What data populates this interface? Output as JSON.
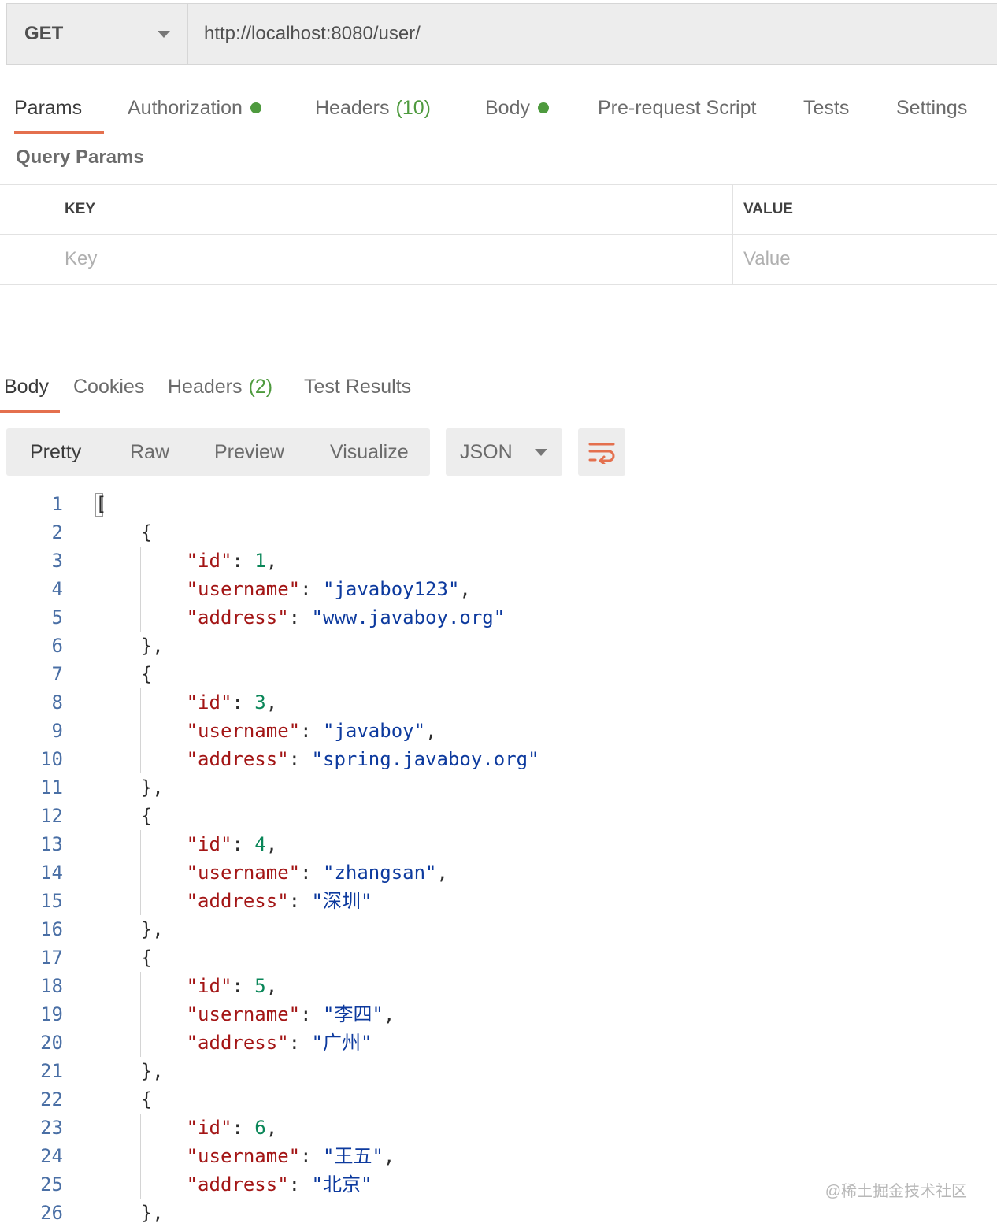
{
  "request": {
    "method": "GET",
    "url": "http://localhost:8080/user/"
  },
  "request_tabs": {
    "params": "Params",
    "authorization": "Authorization",
    "headers": "Headers",
    "headers_count": "(10)",
    "body": "Body",
    "prerequest": "Pre-request Script",
    "tests": "Tests",
    "settings": "Settings"
  },
  "query_params": {
    "title": "Query Params",
    "key_header": "KEY",
    "value_header": "VALUE",
    "key_placeholder": "Key",
    "value_placeholder": "Value"
  },
  "response_tabs": {
    "body": "Body",
    "cookies": "Cookies",
    "headers": "Headers",
    "headers_count": "(2)",
    "test_results": "Test Results"
  },
  "view_modes": {
    "pretty": "Pretty",
    "raw": "Raw",
    "preview": "Preview",
    "visualize": "Visualize",
    "format": "JSON"
  },
  "colors": {
    "accent": "#e4704e",
    "status_dot": "#4e9a3e",
    "json_key": "#a31515",
    "json_string": "#0d3a9e",
    "json_number": "#098658"
  },
  "response_json": [
    {
      "id": "1",
      "username": "javaboy123",
      "address": "www.javaboy.org"
    },
    {
      "id": "3",
      "username": "javaboy",
      "address": "spring.javaboy.org"
    },
    {
      "id": "4",
      "username": "zhangsan",
      "address": "深圳"
    },
    {
      "id": "5",
      "username": "李四",
      "address": "广州"
    },
    {
      "id": "6",
      "username": "王五",
      "address": "北京"
    }
  ],
  "watermark": "@稀土掘金技术社区"
}
